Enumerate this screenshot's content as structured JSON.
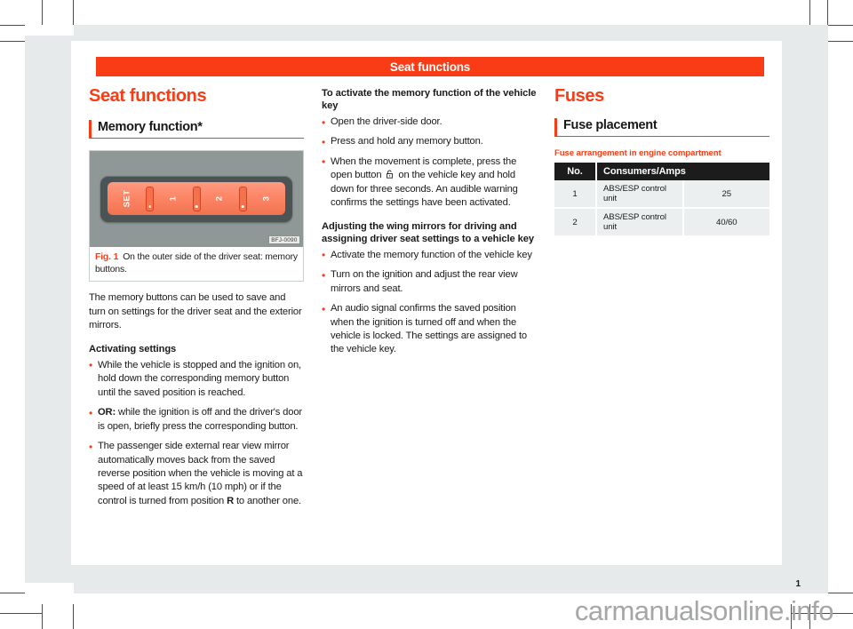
{
  "document": {
    "running_head": "Seat functions",
    "folio": "1",
    "watermark": "carmanualsonline.info",
    "accent_color": "#f93c16",
    "header_text_color": "#ffffff",
    "surround_color": "#e6eaeb"
  },
  "left_column": {
    "heading": "Seat functions",
    "section_heading": "Memory function*",
    "figure": {
      "image_code": "BFJ-0090",
      "caption_number": "Fig. 1",
      "caption_text": "On the outer side of the driver seat: memory buttons.",
      "keys": [
        {
          "label": "SET"
        },
        {
          "label": "1"
        },
        {
          "label": "2"
        },
        {
          "label": "3"
        }
      ]
    },
    "intro": "The memory buttons can be used to save and turn on settings for the driver seat and the exterior mirrors.",
    "subheading": "Activating settings",
    "bullets": [
      "While the vehicle is stopped and the ignition on, hold down the corresponding memory button until the saved position is reached.",
      "OR: while the ignition is off and the driver's door is open, briefly press the corresponding button.",
      "The passenger side external rear view mirror automatically moves back from the saved reverse position when the vehicle is moving at a speed of at least 15 km/h (10 mph) or if the control is turned from position R to another one."
    ],
    "bullet2_lead": "OR:",
    "bullet2_rest": " while the ignition is off and the driver's door is open, briefly press the corresponding button.",
    "bullet3_part1": "The passenger side external rear view mirror automatically moves back from the saved reverse position when the vehicle is moving at a speed of at least 15 km/h (10 mph) or if the control is turned from position ",
    "bullet3_bold": "R",
    "bullet3_part2": " to another one."
  },
  "middle_column": {
    "heading1": "To activate the memory function of the vehicle key",
    "bullets1": [
      "Open the driver-side door.",
      "Press and hold any memory button."
    ],
    "bullet1_3_part1": "When the movement is complete, press the open button ",
    "bullet1_3_icon": "unlock-padlock-icon",
    "bullet1_3_part2": " on the vehicle key and hold down for three seconds. An audible warning confirms the settings have been activated.",
    "heading2": "Adjusting the wing mirrors for driving and assigning driver seat settings to a vehicle key",
    "bullets2": [
      "Activate the memory function of the vehicle key",
      "Turn on the ignition and adjust the rear view mirrors and seat.",
      "An audio signal confirms the saved position when the ignition is turned off and when the vehicle is locked. The settings are assigned to the vehicle key."
    ]
  },
  "right_column": {
    "heading": "Fuses",
    "section_heading": "Fuse placement",
    "table_caption": "Fuse arrangement in engine compartment",
    "table": {
      "headers": [
        "No.",
        "Consumers/Amps",
        ""
      ],
      "rows": [
        {
          "no": "1",
          "consumer": "ABS/ESP control unit",
          "amps": "25"
        },
        {
          "no": "2",
          "consumer": "ABS/ESP control unit",
          "amps": "40/60"
        }
      ]
    }
  }
}
